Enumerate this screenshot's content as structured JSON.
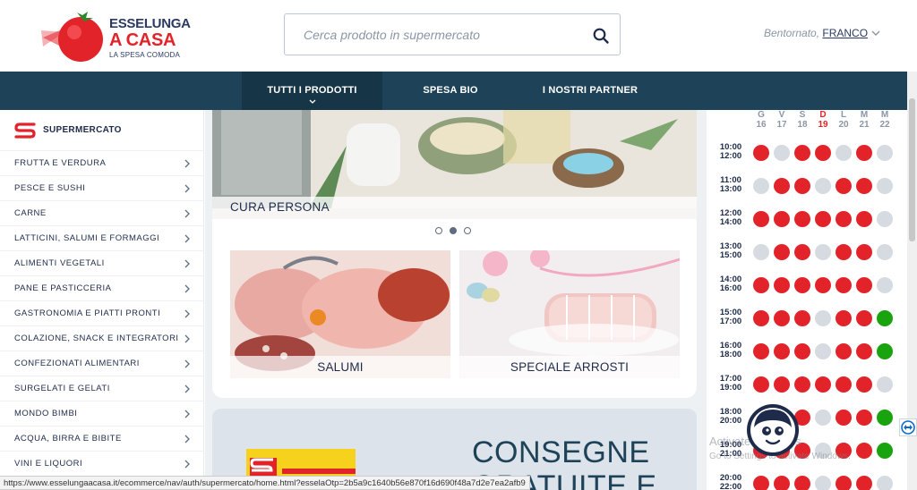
{
  "header": {
    "logo": {
      "line1": "ESSELUNGA",
      "line2": "A CASA",
      "tagline": "LA SPESA COMODA"
    },
    "search": {
      "placeholder": "Cerca prodotto in supermercato",
      "icon": "search-icon"
    },
    "user": {
      "greeting": "Bentornato,",
      "name": "FRANCO"
    }
  },
  "nav": {
    "items": [
      {
        "label": "TUTTI I PRODOTTI",
        "active": true
      },
      {
        "label": "SPESA BIO",
        "active": false
      },
      {
        "label": "I NOSTRI PARTNER",
        "active": false
      }
    ]
  },
  "sidebar": {
    "title": "SUPERMERCATO",
    "items": [
      "FRUTTA E VERDURA",
      "PESCE E SUSHI",
      "CARNE",
      "LATTICINI, SALUMI E FORMAGGI",
      "ALIMENTI VEGETALI",
      "PANE E PASTICCERIA",
      "GASTRONOMIA E PIATTI PRONTI",
      "COLAZIONE, SNACK E INTEGRATORI",
      "CONFEZIONATI ALIMENTARI",
      "SURGELATI E GELATI",
      "MONDO BIMBI",
      "ACQUA, BIRRA E BIBITE",
      "VINI E LIQUORI"
    ]
  },
  "main": {
    "hero_caption": "CURA PERSONA",
    "carousel": {
      "count": 3,
      "active": 1
    },
    "tiles": [
      {
        "caption": "SALUMI"
      },
      {
        "caption": "SPECIALE ARROSTI"
      }
    ],
    "promo": {
      "line1": "CONSEGNE",
      "line2": "GRATUITE E"
    }
  },
  "calendar": {
    "days": [
      {
        "letter": "G",
        "num": "16",
        "highlight": false
      },
      {
        "letter": "V",
        "num": "17",
        "highlight": false
      },
      {
        "letter": "S",
        "num": "18",
        "highlight": false
      },
      {
        "letter": "D",
        "num": "19",
        "highlight": true
      },
      {
        "letter": "L",
        "num": "20",
        "highlight": false
      },
      {
        "letter": "M",
        "num": "21",
        "highlight": false
      },
      {
        "letter": "M",
        "num": "22",
        "highlight": false
      }
    ],
    "slots": [
      {
        "from": "10:00",
        "to": "12:00",
        "states": [
          "red",
          "gray",
          "red",
          "red",
          "gray",
          "red",
          "gray"
        ]
      },
      {
        "from": "11:00",
        "to": "13:00",
        "states": [
          "gray",
          "red",
          "red",
          "gray",
          "red",
          "red",
          "gray"
        ]
      },
      {
        "from": "12:00",
        "to": "14:00",
        "states": [
          "red",
          "red",
          "red",
          "red",
          "red",
          "red",
          "gray"
        ]
      },
      {
        "from": "13:00",
        "to": "15:00",
        "states": [
          "gray",
          "red",
          "red",
          "gray",
          "red",
          "red",
          "gray"
        ]
      },
      {
        "from": "14:00",
        "to": "16:00",
        "states": [
          "red",
          "red",
          "red",
          "red",
          "red",
          "red",
          "gray"
        ]
      },
      {
        "from": "15:00",
        "to": "17:00",
        "states": [
          "red",
          "red",
          "red",
          "gray",
          "red",
          "red",
          "green"
        ]
      },
      {
        "from": "16:00",
        "to": "18:00",
        "states": [
          "red",
          "red",
          "red",
          "gray",
          "red",
          "red",
          "green"
        ]
      },
      {
        "from": "17:00",
        "to": "19:00",
        "states": [
          "red",
          "red",
          "red",
          "red",
          "red",
          "red",
          "gray"
        ]
      },
      {
        "from": "18:00",
        "to": "20:00",
        "states": [
          "red",
          "red",
          "red",
          "gray",
          "red",
          "red",
          "green"
        ]
      },
      {
        "from": "19:00",
        "to": "21:00",
        "states": [
          "red",
          "red",
          "red",
          "gray",
          "red",
          "red",
          "green"
        ]
      },
      {
        "from": "20:00",
        "to": "22:00",
        "states": [
          "red",
          "red",
          "red",
          "gray",
          "red",
          "red",
          "gray"
        ]
      }
    ],
    "colors": {
      "red": "#e3232a",
      "gray": "#d6dbe1",
      "green": "#19a30e"
    }
  },
  "status_bar": "https://www.esselungaacasa.it/ecommerce/nav/auth/supermercato/home.html?esselaOtp=2b5a9c1640b56e870f16d690f48a7d2e7ea2afb9",
  "watermark": {
    "line1": "Activate Windows",
    "line2": "Go to Settings to activate Windows."
  }
}
